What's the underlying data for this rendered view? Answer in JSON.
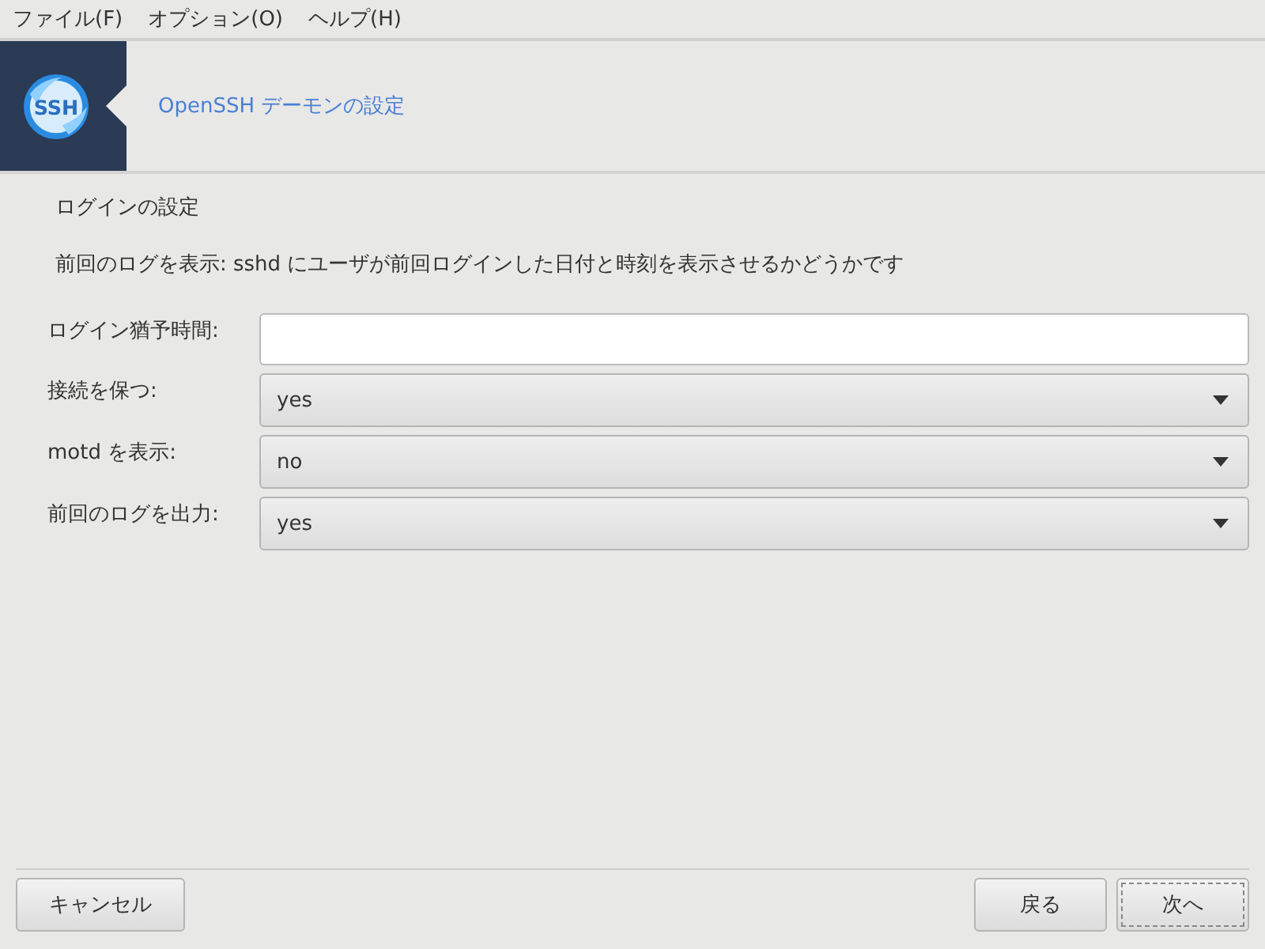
{
  "menu_bar": [
    {
      "label": "ファイル(F)"
    },
    {
      "label": "オプション(O)"
    },
    {
      "label": "ヘルプ(H)"
    }
  ],
  "header": {
    "logo_text": "SSH",
    "title": "OpenSSH デーモンの設定"
  },
  "section_title": "ログインの設定",
  "description": "前回のログを表示: sshd にユーザが前回ログインした日付と時刻を表示させるかどうかです",
  "fields": [
    {
      "kind": "text",
      "label": "ログイン猶予時間:"
    },
    {
      "kind": "dropdown",
      "label": "接続を保つ:",
      "value": "yes"
    },
    {
      "kind": "dropdown",
      "label": "motd を表示:",
      "value": "no"
    },
    {
      "kind": "dropdown",
      "label": "前回のログを出力:",
      "value": "yes"
    }
  ],
  "buttons_left": [
    {
      "label": "キャンセル",
      "focused": false
    }
  ],
  "buttons_right": [
    {
      "label": "戻る",
      "focused": false
    },
    {
      "label": "次へ",
      "focused": true
    }
  ]
}
